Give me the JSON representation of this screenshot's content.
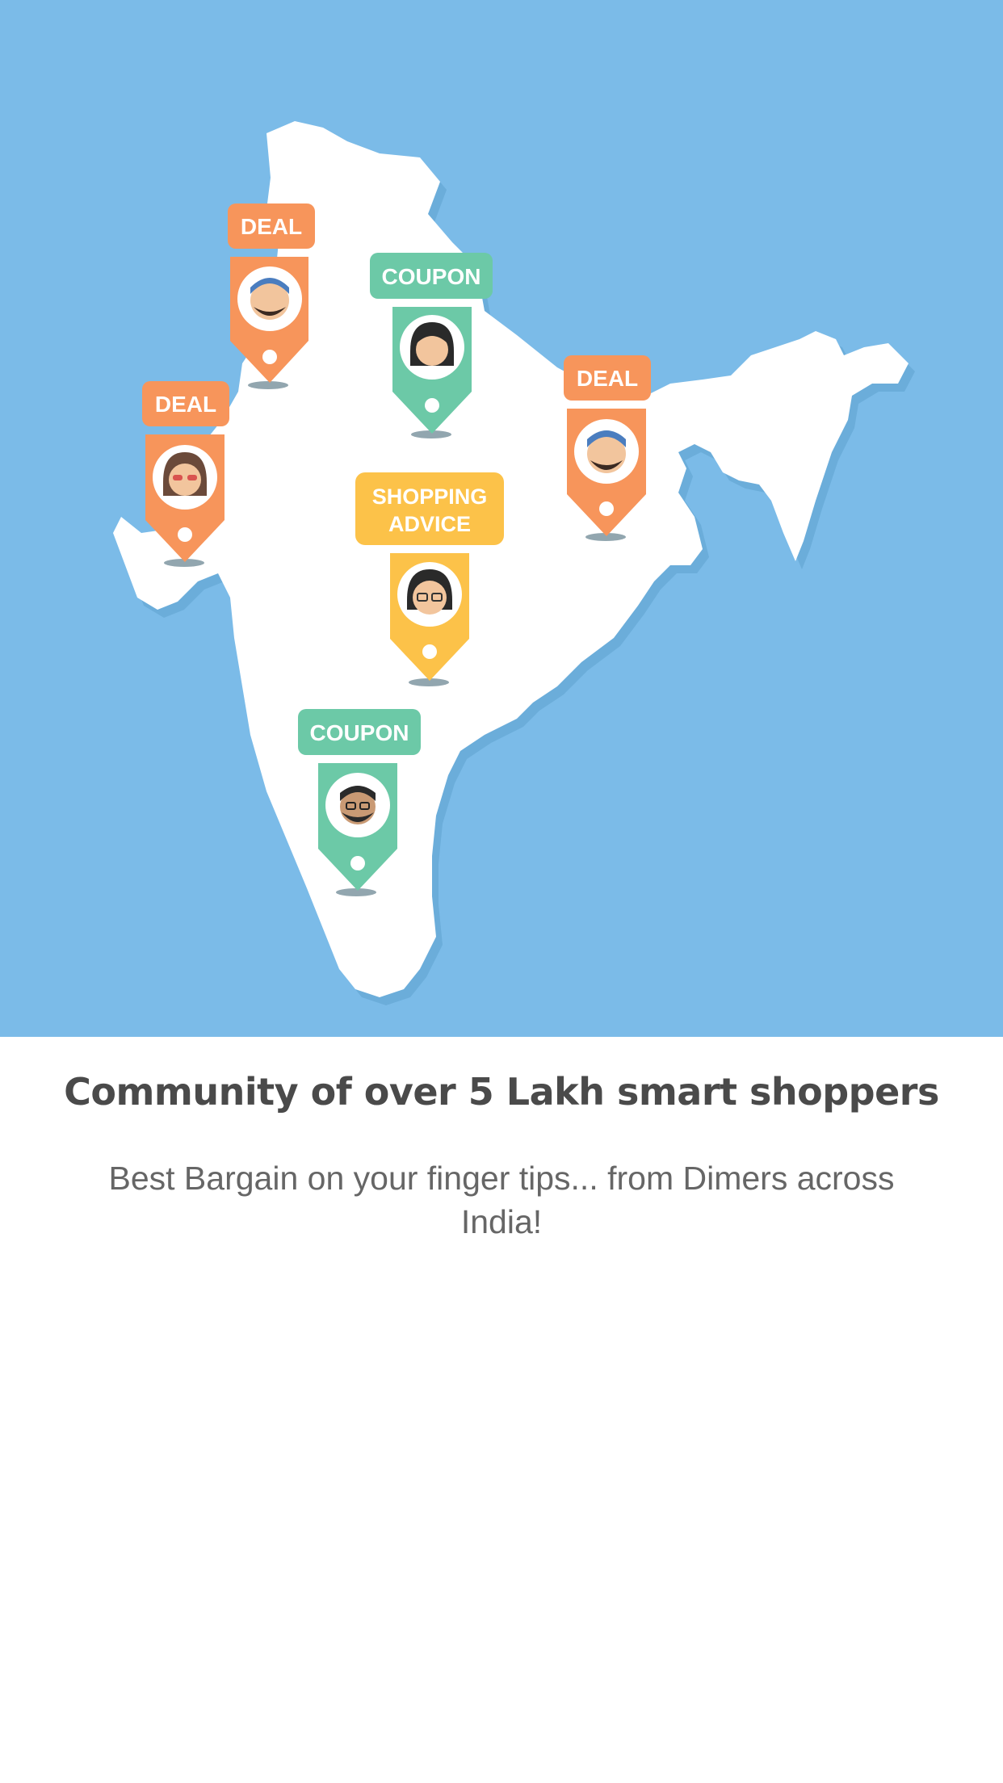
{
  "hero": {
    "pins": [
      {
        "label": "DEAL",
        "color": "#f7955b"
      },
      {
        "label": "COUPON",
        "color": "#6cc9a7"
      },
      {
        "label": "DEAL",
        "color": "#f7955b"
      },
      {
        "label": "DEAL",
        "color": "#f7955b"
      },
      {
        "label_line1": "SHOPPING",
        "label_line2": "ADVICE",
        "color": "#fcc249"
      },
      {
        "label": "COUPON",
        "color": "#6cc9a7"
      }
    ],
    "map_icon": "india-map"
  },
  "content": {
    "headline": "Community of over 5 Lakh smart shoppers",
    "subtext": "Best Bargain on your finger tips... from Dimers across India!"
  },
  "colors": {
    "sky": "#7bbbe8",
    "map": "#ffffff",
    "deal": "#f7955b",
    "coupon": "#6cc9a7",
    "advice": "#fcc249",
    "text": "#4a4a4a"
  }
}
